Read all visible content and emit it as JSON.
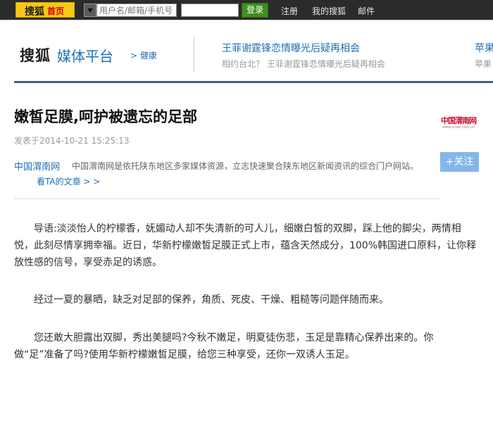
{
  "topbar": {
    "logo": "搜狐",
    "home": "首页",
    "user_placeholder": "用户名/邮箱/手机号",
    "login_label": "登录",
    "register": "注册",
    "my_sohu": "我的搜狐",
    "mail": "邮件"
  },
  "header": {
    "brand": "搜狐",
    "brand_sub": "媒体平台",
    "channel": "> 健康",
    "headline1": "王菲谢霆锋恋情曝光后疑再相会",
    "headline1_sub": "相约台北？ 王菲谢霆锋恋情曝光后疑再相会",
    "headline2": "苹果",
    "headline2_sub": "苹果"
  },
  "article": {
    "title": "嫩皙足膜,呵护被遗忘的足部",
    "published": "发表于2014-10-21 15:25:13",
    "source_logo": "中国渭南网",
    "source_logo_sub": "www.cnwn.com.cn",
    "source_name": "中国渭南网",
    "source_desc": "中国渭南网是依托陕东地区多家媒体资源，立志快速聚合陕东地区新闻资讯的综合门户网站。",
    "follow_label": "+关注",
    "more_label": "看TA的文章 > >",
    "p1_line1": "导语:淡淡怡人的柠檬香，妩媚动人却不失清新的可人儿，细嫩白皙的双脚，踩上他的脚尖，两情相",
    "p1_line2": "悦，此刻尽情享拥幸福。近日，华新柠檬嫩皙足膜正式上市，蕴含天然成分，100%韩国进口原料，让你释",
    "p1_line3": "放性感的信号，享受赤足的诱惑。",
    "p2": "经过一夏的暴晒，缺乏对足部的保养，角质、死皮、干燥、粗糙等问题伴随而来。",
    "p3_line1": "您还敢大胆露出双脚，秀出美腿吗?今秋不嫩足，明夏徒伤悲，玉足是靠精心保养出来的。你",
    "p3_line2": "做“足”准备了吗?使用华新柠檬嫩皙足膜，给您三种享受，还你一双诱人玉足。"
  }
}
